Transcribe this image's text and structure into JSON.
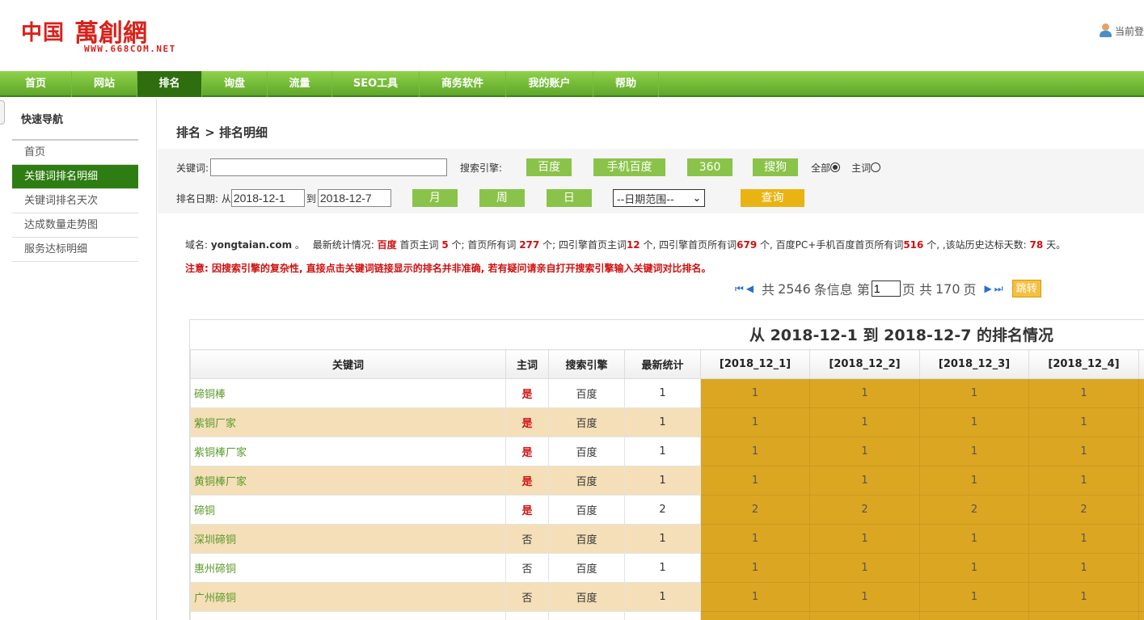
{
  "header": {
    "logo_cn": "中国",
    "logo_brand": "萬創網",
    "logo_url": "WWW.668COM.NET",
    "user_text": "当前登"
  },
  "nav": [
    {
      "label": "首页",
      "active": false
    },
    {
      "label": "网站",
      "active": false
    },
    {
      "label": "排名",
      "active": true
    },
    {
      "label": "询盘",
      "active": false
    },
    {
      "label": "流量",
      "active": false
    },
    {
      "label": "SEO工具",
      "active": false
    },
    {
      "label": "商务软件",
      "active": false
    },
    {
      "label": "我的账户",
      "active": false
    },
    {
      "label": "帮助",
      "active": false
    }
  ],
  "sidebar": {
    "title": "快速导航",
    "items": [
      {
        "label": "首页",
        "active": false
      },
      {
        "label": "关键词排名明细",
        "active": true
      },
      {
        "label": "关键词排名天次",
        "active": false
      },
      {
        "label": "达成数量走势图",
        "active": false
      },
      {
        "label": "服务达标明细",
        "active": false
      }
    ]
  },
  "page": {
    "title": "排名 > 排名明细"
  },
  "filters": {
    "keyword_label": "关键词:",
    "keyword_value": "",
    "engine_label": "搜索引擎:",
    "engines": [
      "百度",
      "手机百度",
      "360",
      "搜狗"
    ],
    "scope_all": "全部",
    "scope_main": "主词",
    "date_label": "排名日期: 从",
    "date_from": "2018-12-1",
    "date_to_label": "到",
    "date_to": "2018-12-7",
    "periods": [
      "月",
      "周",
      "日"
    ],
    "range_select": "--日期范围--",
    "query_button": "查询"
  },
  "stats": {
    "domain_label": "域名:",
    "domain": "yongtaian.com",
    "sep": "。",
    "summary_label": "最新统计情况:",
    "engine": "百度",
    "p1": "首页主词",
    "v1": "5",
    "p2": "个; 首页所有词",
    "v2": "277",
    "p3": "个; 四引擎首页主词",
    "v3": "12",
    "p4": "个, 四引擎首页所有词",
    "v4": "679",
    "p5": "个, 百度PC+手机百度首页所有词",
    "v5": "516",
    "p6": "个, ,该站历史达标天数:",
    "v6": "78",
    "p7": "天。"
  },
  "notice": "注意: 因搜索引擎的复杂性, 直接点击关键词链接显示的排名并非准确, 若有疑问请亲自打开搜索引擎输入关键词对比排名。",
  "pager": {
    "total_prefix": "共",
    "total": "2546",
    "total_suffix": "条信息 第",
    "current_page": "1",
    "page_suffix": "页 共",
    "page_count": "170",
    "page_count_suffix": "页",
    "jump_label": "跳转"
  },
  "table": {
    "caption": "从 2018-12-1 到 2018-12-7 的排名情况",
    "headers": [
      "关键词",
      "主词",
      "搜索引擎",
      "最新统计",
      "[2018_12_1]",
      "[2018_12_2]",
      "[2018_12_3]",
      "[2018_12_4]"
    ],
    "rows": [
      {
        "keyword": "碲铜棒",
        "main": "是",
        "engine": "百度",
        "latest": "1",
        "d1": "1",
        "d2": "1",
        "d3": "1",
        "d4": "1"
      },
      {
        "keyword": "紫铜厂家",
        "main": "是",
        "engine": "百度",
        "latest": "1",
        "d1": "1",
        "d2": "1",
        "d3": "1",
        "d4": "1"
      },
      {
        "keyword": "紫铜棒厂家",
        "main": "是",
        "engine": "百度",
        "latest": "1",
        "d1": "1",
        "d2": "1",
        "d3": "1",
        "d4": "1"
      },
      {
        "keyword": "黄铜棒厂家",
        "main": "是",
        "engine": "百度",
        "latest": "1",
        "d1": "1",
        "d2": "1",
        "d3": "1",
        "d4": "1"
      },
      {
        "keyword": "碲铜",
        "main": "是",
        "engine": "百度",
        "latest": "2",
        "d1": "2",
        "d2": "2",
        "d3": "2",
        "d4": "2"
      },
      {
        "keyword": "深圳碲铜",
        "main": "否",
        "engine": "百度",
        "latest": "1",
        "d1": "1",
        "d2": "1",
        "d3": "1",
        "d4": "1"
      },
      {
        "keyword": "惠州碲铜",
        "main": "否",
        "engine": "百度",
        "latest": "1",
        "d1": "1",
        "d2": "1",
        "d3": "1",
        "d4": "1"
      },
      {
        "keyword": "广州碲铜",
        "main": "否",
        "engine": "百度",
        "latest": "1",
        "d1": "1",
        "d2": "1",
        "d3": "1",
        "d4": "1"
      },
      {
        "keyword": "",
        "main": "",
        "engine": "",
        "latest": "",
        "d1": "",
        "d2": "",
        "d3": "",
        "d4": ""
      }
    ]
  }
}
